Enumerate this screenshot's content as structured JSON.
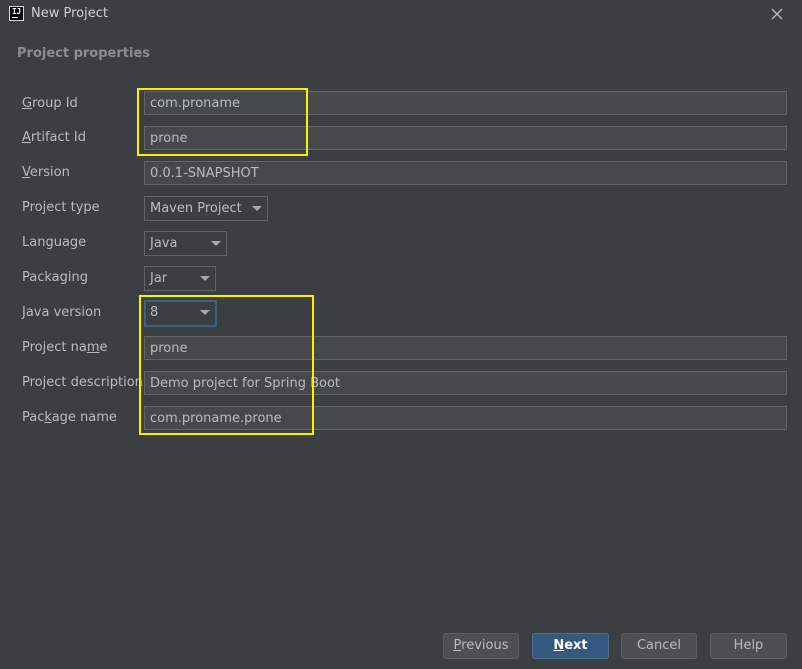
{
  "window": {
    "title": "New Project",
    "app_icon_text": "IJ"
  },
  "section": {
    "title": "Project properties"
  },
  "form": {
    "group_id": {
      "label_mnemonic": "G",
      "label_rest": "roup Id",
      "value": "com.proname"
    },
    "artifact_id": {
      "label_mnemonic": "A",
      "label_rest": "rtifact Id",
      "value": "prone"
    },
    "version": {
      "label_mnemonic": "V",
      "label_rest": "ersion",
      "value": "0.0.1-SNAPSHOT"
    },
    "project_type": {
      "label": "Project type",
      "value": "Maven Project"
    },
    "language": {
      "label": "Language",
      "value": "Java"
    },
    "packaging": {
      "label": "Packaging",
      "value": "Jar"
    },
    "java_version": {
      "label": "Java version",
      "value": "8"
    },
    "project_name": {
      "label_before": "Project na",
      "label_mnemonic": "m",
      "label_after": "e",
      "value": "prone"
    },
    "project_description": {
      "label": "Project description",
      "value": "Demo project for Spring Boot"
    },
    "package_name": {
      "label_before": "Pac",
      "label_mnemonic": "k",
      "label_after": "age name",
      "value": "com.proname.prone"
    }
  },
  "buttons": {
    "previous": {
      "mnemonic": "P",
      "rest": "revious"
    },
    "next": {
      "mnemonic": "N",
      "rest": "ext"
    },
    "cancel": "Cancel",
    "help": "Help"
  },
  "colors": {
    "background": "#3c3f41",
    "field_background": "#45494a",
    "highlight": "#f5f200",
    "default_button": "#365880"
  }
}
